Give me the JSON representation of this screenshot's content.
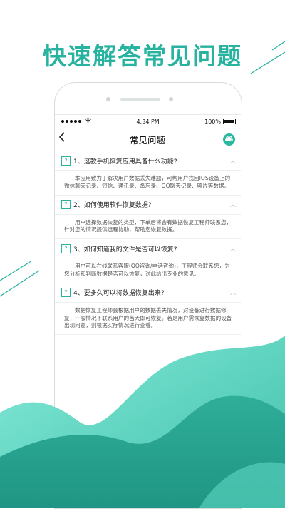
{
  "headline": "快速解答常见问题",
  "colors": {
    "accent": "#27b3a0",
    "wave_light": "#63e2cc",
    "wave_dark": "#2aa692"
  },
  "status_bar": {
    "signal_icon": "signal-dots-icon",
    "wifi_icon": "wifi-icon",
    "time": "4:34 PM",
    "battery": "100%"
  },
  "nav": {
    "back_icon": "chevron-left-icon",
    "title": "常见问题",
    "service_icon": "customer-service-icon"
  },
  "faq": [
    {
      "question": "1、这款手机恢复应用具备什么功能?",
      "answer": "本应用致力于解决用户数据丢失难题，可帮用户找回IOS设备上的微信聊天记录、短信、通讯录、备忘录、QQ聊天记录、照片等数据。"
    },
    {
      "question": "2、如何使用软件恢复数据?",
      "answer": "用户选择数据恢复的类型，下单后将会有数据恢复工程师联系您，针对您的情况提供远程协助，帮助您恢复数据。"
    },
    {
      "question": "3、如何知道我的文件是否可以恢复?",
      "answer": "用户可以在线联系客服(QQ咨询/电话咨询)，工程师会联系您，为您分析和判断数据是否可以恢复，对此给出专业的意见。"
    },
    {
      "question": "4、要多久可以将数据恢复出来?",
      "answer": "数据恢复工程师会根据用户的数据丢失情况，对设备进行数据修复，一般情况下联系用户的当天即可恢复。若是用户需恢复数据的设备出现问题，则根据实际情况进行查看。"
    }
  ]
}
